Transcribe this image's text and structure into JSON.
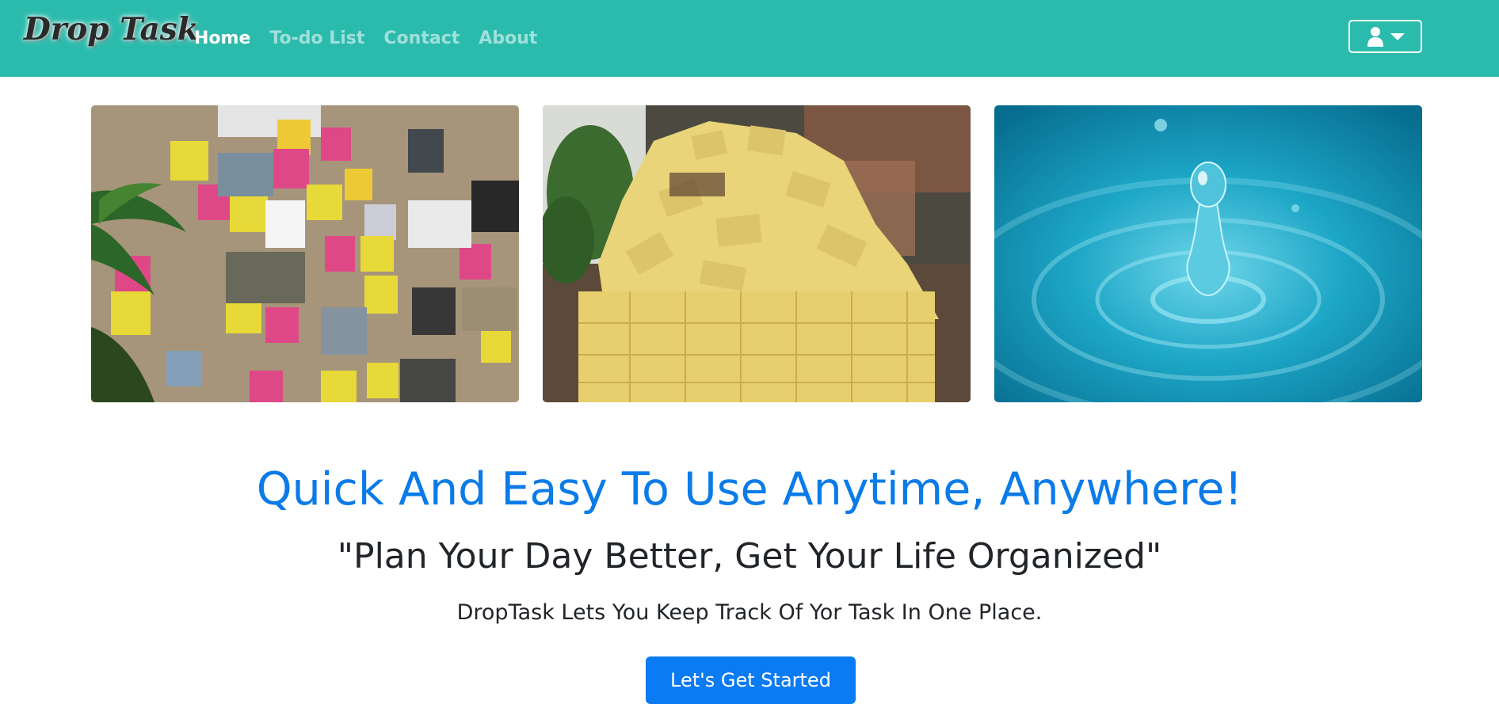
{
  "brand": {
    "name": "Drop Task"
  },
  "nav": {
    "items": [
      {
        "label": "Home",
        "active": true
      },
      {
        "label": "To-do List",
        "active": false
      },
      {
        "label": "Contact",
        "active": false
      },
      {
        "label": "About",
        "active": false
      }
    ]
  },
  "user_menu": {
    "icon": "user-icon",
    "dropdown_icon": "caret-down-icon"
  },
  "gallery": {
    "images": [
      {
        "icon": "sticky-notes-board-image"
      },
      {
        "icon": "person-covered-in-sticky-notes-image"
      },
      {
        "icon": "water-drop-image"
      }
    ]
  },
  "hero": {
    "headline": "Quick And Easy To Use Anytime, Anywhere!",
    "quote": "\"Plan Your Day Better, Get Your Life Organized\"",
    "lead": "DropTask Lets You Keep Track Of Yor Task In One Place.",
    "cta_label": "Let's Get Started"
  },
  "colors": {
    "navbar": "#2bbbad",
    "accent": "#0a7bf3",
    "headline": "#0a7be8"
  }
}
